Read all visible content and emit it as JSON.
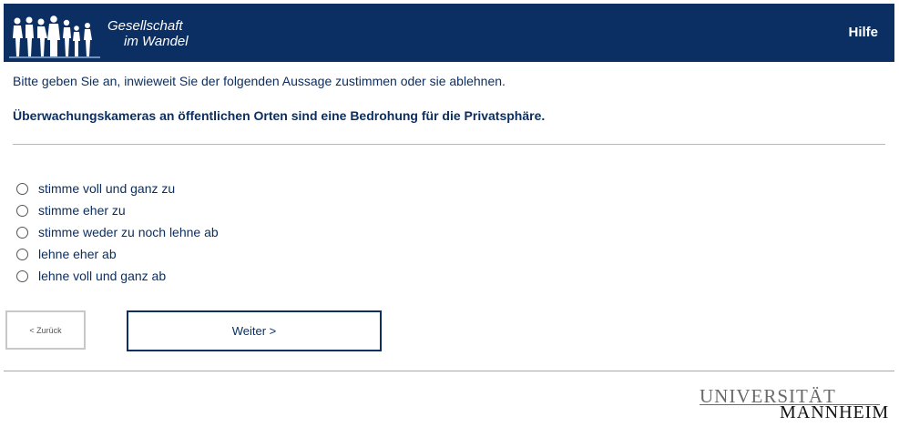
{
  "header": {
    "logo_line1": "Gesellschaft",
    "logo_line2": "im Wandel",
    "help_label": "Hilfe",
    "background_color": "#0b2f62"
  },
  "survey": {
    "instruction": "Bitte geben Sie an, inwieweit Sie der folgenden Aussage zustimmen oder sie ablehnen.",
    "question": "Überwachungskameras an öffentlichen Orten sind eine Bedrohung für die Privatsphäre.",
    "options": [
      {
        "label": "stimme voll und ganz zu",
        "selected": false
      },
      {
        "label": "stimme eher zu",
        "selected": false
      },
      {
        "label": "stimme weder zu noch lehne ab",
        "selected": false
      },
      {
        "label": "lehne eher ab",
        "selected": false
      },
      {
        "label": "lehne voll und ganz ab",
        "selected": false
      }
    ]
  },
  "navigation": {
    "back_label": "< Zurück",
    "next_label": "Weiter >"
  },
  "footer": {
    "university_line1": "UNIVERSITÄT",
    "university_line2": "MANNHEIM"
  },
  "colors": {
    "primary": "#0b2f62",
    "divider": "#b9b9b9"
  }
}
